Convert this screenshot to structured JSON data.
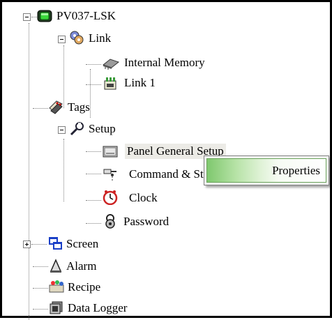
{
  "tree": {
    "root": {
      "label": "PV037-LSK",
      "expanded": true
    },
    "link": {
      "label": "Link",
      "expanded": true
    },
    "internal_memory": {
      "label": "Internal Memory"
    },
    "link1": {
      "label": "Link 1"
    },
    "tags": {
      "label": "Tags"
    },
    "setup": {
      "label": "Setup",
      "expanded": true
    },
    "panel_general_setup": {
      "label": "Panel General Setup",
      "selected": true
    },
    "command": {
      "label": "Command & Status"
    },
    "clock": {
      "label": "Clock"
    },
    "password": {
      "label": "Password"
    },
    "screen": {
      "label": "Screen",
      "expanded": false
    },
    "alarm": {
      "label": "Alarm"
    },
    "recipe": {
      "label": "Recipe"
    },
    "data_logger": {
      "label": "Data Logger"
    }
  },
  "context_menu": {
    "items": [
      {
        "label": "Properties",
        "highlighted": true
      }
    ]
  },
  "colors": {
    "selection": "#ecebe6",
    "menu_highlight": "#7fc86e",
    "tree_line": "#808080"
  }
}
